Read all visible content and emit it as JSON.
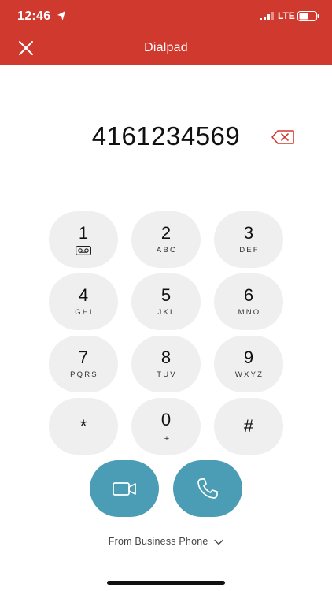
{
  "status_bar": {
    "time": "12:46",
    "network": "LTE"
  },
  "header": {
    "title": "Dialpad"
  },
  "dial": {
    "number": "4161234569"
  },
  "keypad": [
    {
      "digit": "1",
      "letters": ""
    },
    {
      "digit": "2",
      "letters": "ABC"
    },
    {
      "digit": "3",
      "letters": "DEF"
    },
    {
      "digit": "4",
      "letters": "GHI"
    },
    {
      "digit": "5",
      "letters": "JKL"
    },
    {
      "digit": "6",
      "letters": "MNO"
    },
    {
      "digit": "7",
      "letters": "PQRS"
    },
    {
      "digit": "8",
      "letters": "TUV"
    },
    {
      "digit": "9",
      "letters": "WXYZ"
    },
    {
      "digit": "*",
      "letters": ""
    },
    {
      "digit": "0",
      "letters": "+"
    },
    {
      "digit": "#",
      "letters": ""
    }
  ],
  "footer": {
    "from_label": "From Business Phone"
  },
  "colors": {
    "header": "#d0392e",
    "call_button": "#4a9db5",
    "key_background": "#efefef"
  },
  "icons": {
    "voicemail": "voicemail-icon",
    "video": "video-call-icon",
    "phone": "phone-icon",
    "backspace": "backspace-icon",
    "close": "close-icon"
  }
}
